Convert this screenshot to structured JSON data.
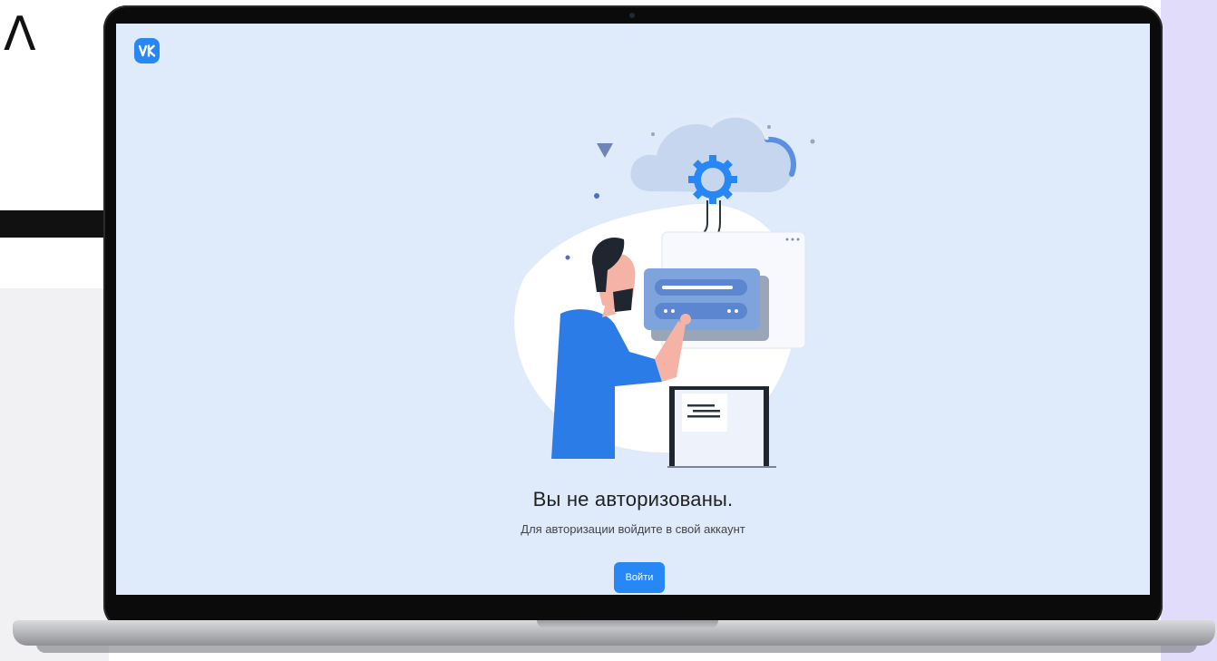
{
  "colors": {
    "accent": "#2787f5",
    "screen_background": "#dfeafa",
    "lavender_panel": "#e2dcfb"
  },
  "background": {
    "glyph": "Λ"
  },
  "app": {
    "logo": "vk-logo-icon"
  },
  "message": {
    "title": "Вы не авторизованы.",
    "subtitle": "Для авторизации войдите в свой аккаунт"
  },
  "actions": {
    "login_label": "Войти"
  }
}
